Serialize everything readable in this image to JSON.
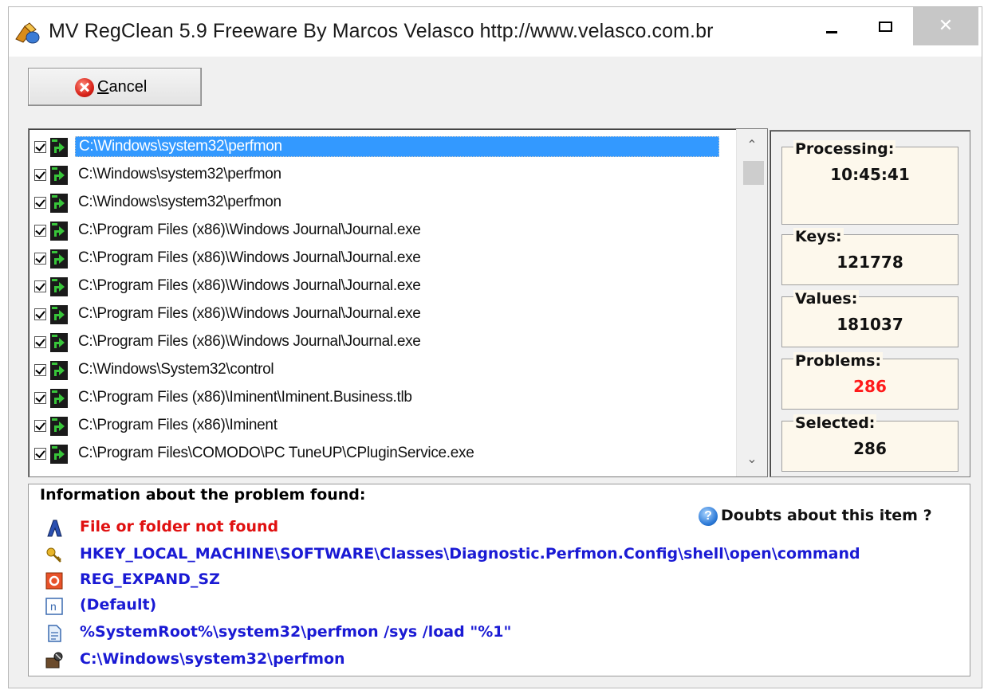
{
  "window": {
    "title": "MV RegClean 5.9 Freeware   By Marcos Velasco   http://www.velasco.com.br",
    "close_glyph": "✕"
  },
  "toolbar": {
    "cancel_prefix": "C",
    "cancel_rest": "ancel"
  },
  "list": {
    "items": [
      {
        "path": "C:\\Windows\\system32\\perfmon",
        "checked": true,
        "selected": true
      },
      {
        "path": "C:\\Windows\\system32\\perfmon",
        "checked": true
      },
      {
        "path": "C:\\Windows\\system32\\perfmon",
        "checked": true
      },
      {
        "path": "C:\\Program Files (x86)\\Windows Journal\\Journal.exe",
        "checked": true
      },
      {
        "path": "C:\\Program Files (x86)\\Windows Journal\\Journal.exe",
        "checked": true
      },
      {
        "path": "C:\\Program Files (x86)\\Windows Journal\\Journal.exe",
        "checked": true
      },
      {
        "path": "C:\\Program Files (x86)\\Windows Journal\\Journal.exe",
        "checked": true
      },
      {
        "path": "C:\\Program Files (x86)\\Windows Journal\\Journal.exe",
        "checked": true
      },
      {
        "path": "C:\\Windows\\System32\\control",
        "checked": true
      },
      {
        "path": "C:\\Program Files (x86)\\Iminent\\Iminent.Business.tlb",
        "checked": true
      },
      {
        "path": "C:\\Program Files (x86)\\Iminent",
        "checked": true
      },
      {
        "path": "C:\\Program Files\\COMODO\\PC TuneUP\\CPluginService.exe",
        "checked": true
      }
    ],
    "scroll_up_glyph": "⌃",
    "scroll_down_glyph": "⌄"
  },
  "stats": {
    "processing_label": "Processing:",
    "processing_value": "10:45:41",
    "keys_label": "Keys:",
    "keys_value": "121778",
    "values_label": "Values:",
    "values_value": "181037",
    "problems_label": "Problems:",
    "problems_value": "286",
    "selected_label": "Selected:",
    "selected_value": "286"
  },
  "info": {
    "title": "Information about the problem found:",
    "doubts_label": "Doubts about this item ?",
    "problem": "File or folder not found",
    "key": "HKEY_LOCAL_MACHINE\\SOFTWARE\\Classes\\Diagnostic.Perfmon.Config\\shell\\open\\command",
    "type": "REG_EXPAND_SZ",
    "name": "(Default)",
    "data": "%SystemRoot%\\system32\\perfmon /sys /load \"%1\"",
    "target": "C:\\Windows\\system32\\perfmon"
  },
  "colors": {
    "selection": "#3399ff",
    "problems_value": "#ff1a1a",
    "info_text": "#1a1ad4",
    "problem_text": "#e01010"
  }
}
